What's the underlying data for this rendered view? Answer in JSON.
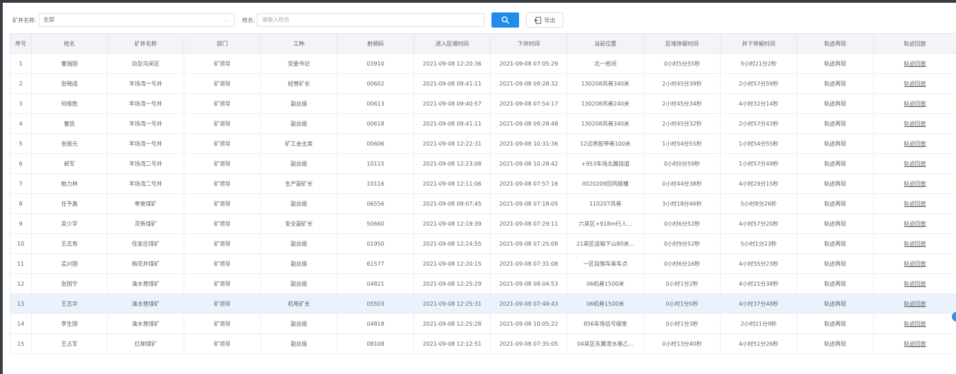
{
  "filters": {
    "mine_label": "矿井名称:",
    "mine_value": "全部",
    "name_label": "姓名:",
    "name_placeholder": "请输入姓名",
    "export_label": "导出"
  },
  "table": {
    "headers": [
      "序号",
      "姓名",
      "矿井名称",
      "部门",
      "工种",
      "射频码",
      "进入区域时间",
      "下井时间",
      "当前位置",
      "区域停留时间",
      "井下停留时间",
      "轨迹再现",
      "轨迹回放"
    ],
    "rows": [
      [
        "1",
        "曹瑞国",
        "白彭沟采区",
        "矿领导",
        "党委书记",
        "03910",
        "2021-09-08 12:20:36",
        "2021-09-08 07:05:29",
        "北一密闭",
        "0小时5分55秒",
        "5小时21分2秒",
        "轨迹再现",
        "轨迹回放"
      ],
      [
        "2",
        "张晓成",
        "羊场湾一号井",
        "矿领导",
        "经营矿长",
        "00602",
        "2021-09-08 09:41:11",
        "2021-09-08 09:28:32",
        "130208风巷340米",
        "2小时45分39秒",
        "2小时57分59秒",
        "轨迹再现",
        "轨迹回放"
      ],
      [
        "3",
        "何维胜",
        "羊场湾一号井",
        "矿领导",
        "副总级",
        "00613",
        "2021-09-08 09:40:57",
        "2021-09-08 07:54:17",
        "130208风巷240米",
        "2小时45分34秒",
        "4小时32分14秒",
        "轨迹再现",
        "轨迹回放"
      ],
      [
        "4",
        "曹凯",
        "羊场湾一号井",
        "矿领导",
        "副总级",
        "00618",
        "2021-09-08 09:41:11",
        "2021-09-08 09:28:48",
        "130208风巷340米",
        "2小时45分32秒",
        "2小时57分43秒",
        "轨迹再现",
        "轨迹回放"
      ],
      [
        "5",
        "张振元",
        "羊场湾一号井",
        "矿领导",
        "矿工会主席",
        "00606",
        "2021-09-08 12:22:31",
        "2021-09-08 10:31:36",
        "12边界胶带巷100米",
        "1小时54分55秒",
        "1小时54分55秒",
        "轨迹再现",
        "轨迹回放"
      ],
      [
        "6",
        "郝军",
        "羊场湾二号井",
        "矿领导",
        "副总级",
        "10115",
        "2021-09-08 12:23:08",
        "2021-09-08 10:28:42",
        "+953车场北翼绕道",
        "0小时0分59秒",
        "1小时57分49秒",
        "轨迹再现",
        "轨迹回放"
      ],
      [
        "7",
        "勉力林",
        "羊场湾二号井",
        "矿领导",
        "生产副矿长",
        "10116",
        "2021-09-08 12:11:06",
        "2021-09-08 07:57:16",
        "II020209回风顺槽",
        "0小时44分38秒",
        "4小时29分15秒",
        "轨迹再现",
        "轨迹回放"
      ],
      [
        "8",
        "任予鑫",
        "枣泉煤矿",
        "矿领导",
        "副总级",
        "06556",
        "2021-09-08 09:07:45",
        "2021-09-08 07:18:05",
        "110207风巷",
        "3小时18分46秒",
        "5小时8分26秒",
        "轨迹再现",
        "轨迹回放"
      ],
      [
        "9",
        "吴少学",
        "灵新煤矿",
        "矿领导",
        "安全副矿长",
        "50660",
        "2021-09-08 12:19:39",
        "2021-09-08 07:29:11",
        "六采区+918m行人...",
        "0小时6分52秒",
        "4小时57分20秒",
        "轨迹再现",
        "轨迹回放"
      ],
      [
        "10",
        "王志寿",
        "任家庄煤矿",
        "矿领导",
        "副总级",
        "01950",
        "2021-09-08 12:24:55",
        "2021-09-08 07:25:08",
        "21采区运输下山80米...",
        "0小时9分52秒",
        "5小时1分23秒",
        "轨迹再现",
        "轨迹回放"
      ],
      [
        "11",
        "孟兴国",
        "梅花井煤矿",
        "矿领导",
        "副总级",
        "61577",
        "2021-09-08 12:20:15",
        "2021-09-08 07:31:08",
        "一区段猴车乘车点",
        "0小时6分16秒",
        "4小时55分23秒",
        "轨迹再现",
        "轨迹回放"
      ],
      [
        "12",
        "张国宁",
        "清水营煤矿",
        "矿领导",
        "副总级",
        "04821",
        "2021-09-08 12:25:29",
        "2021-09-08 08:04:53",
        "06机巷1500米",
        "0小时1分2秒",
        "4小时21分38秒",
        "轨迹再现",
        "轨迹回放"
      ],
      [
        "13",
        "王志华",
        "清水营煤矿",
        "矿领导",
        "机电矿长",
        "05503",
        "2021-09-08 12:25:31",
        "2021-09-08 07:48:43",
        "06机巷1500米",
        "0小时1分0秒",
        "4小时37分48秒",
        "轨迹再现",
        "轨迹回放"
      ],
      [
        "14",
        "李生国",
        "清水营煤矿",
        "矿领导",
        "副总级",
        "04818",
        "2021-09-08 12:25:28",
        "2021-09-08 10:05:22",
        "856车场信号硐室",
        "0小时1分3秒",
        "2小时21分9秒",
        "轨迹再现",
        "轨迹回放"
      ],
      [
        "15",
        "王占军",
        "红柳煤矿",
        "矿领导",
        "副总级",
        "08108",
        "2021-09-08 12:12:51",
        "2021-09-08 07:35:05",
        "04采区东翼泄水巷乙...",
        "0小时13分40秒",
        "4小时51分26秒",
        "轨迹再现",
        "轨迹回放"
      ]
    ],
    "highlighted_row": 13
  },
  "colors": {
    "primary_button": "#1f8ceb",
    "link": "#2d6fd6",
    "header_bg": "#f2f4f7",
    "highlight_row": "#ecf2fb"
  },
  "icons": {
    "search_button": "search-icon",
    "export_button": "export-icon",
    "select": "chevron-down-icon"
  }
}
